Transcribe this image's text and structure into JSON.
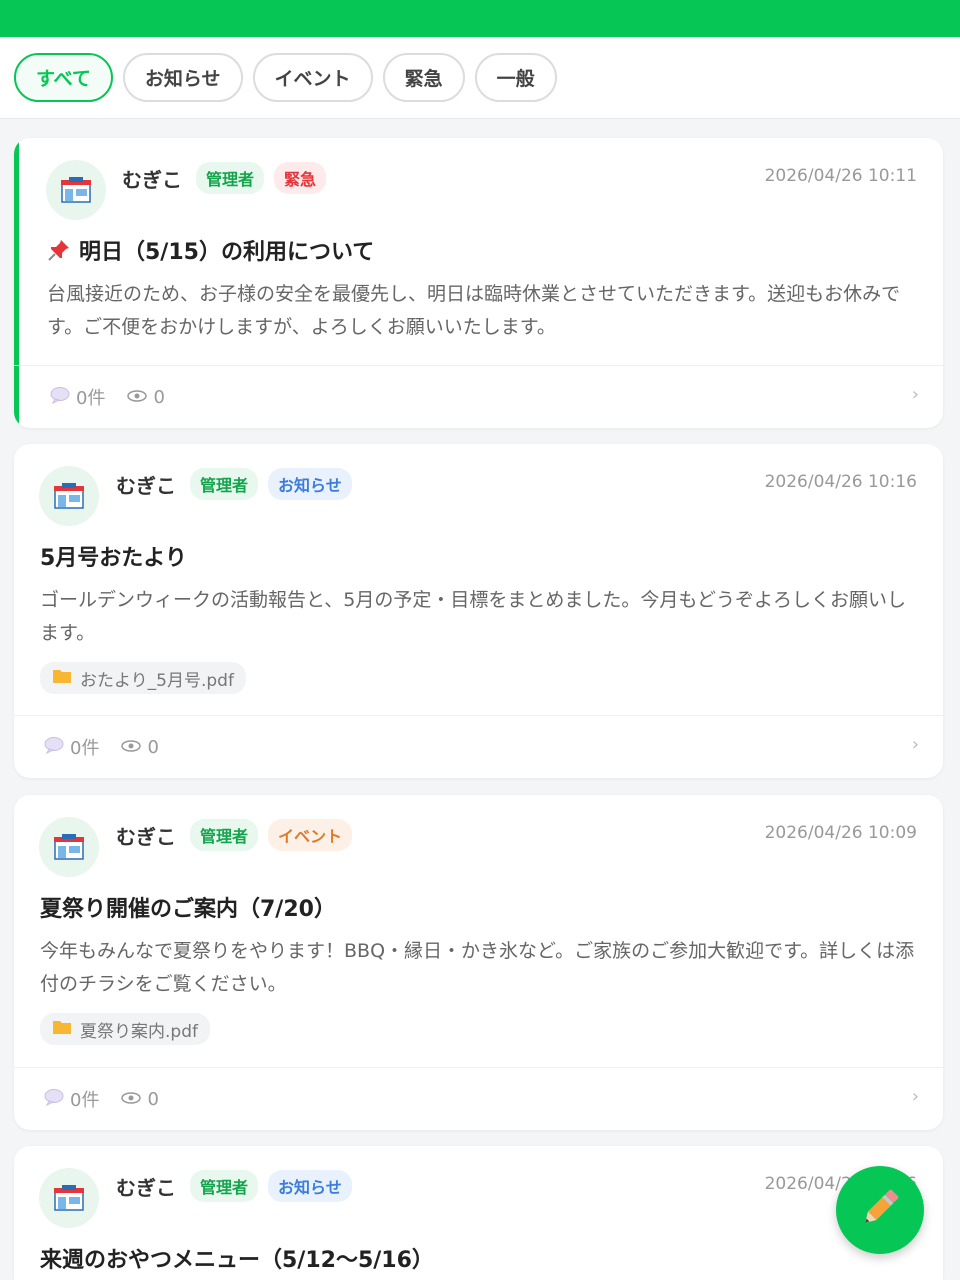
{
  "filters": [
    "すべて",
    "お知らせ",
    "イベント",
    "緊急",
    "一般"
  ],
  "posts": [
    {
      "author": "むぎこ",
      "role": "管理者",
      "category": "緊急",
      "time": "2026/04/26 10:11",
      "pinned": true,
      "title": "明日（5/15）の利用について",
      "body": "台風接近のため、お子様の安全を最優先し、明日は臨時休業とさせていただきます。送迎もお休みです。ご不便をおかけしますが、よろしくお願いいたします。",
      "comments": "0件",
      "views": "0"
    },
    {
      "author": "むぎこ",
      "role": "管理者",
      "category": "お知らせ",
      "time": "2026/04/26 10:16",
      "title": "5月号おたより",
      "body": "ゴールデンウィークの活動報告と、5月の予定・目標をまとめました。今月もどうぞよろしくお願いします。",
      "attachment": "おたより_5月号.pdf",
      "comments": "0件",
      "views": "0"
    },
    {
      "author": "むぎこ",
      "role": "管理者",
      "category": "イベント",
      "time": "2026/04/26 10:09",
      "title": "夏祭り開催のご案内（7/20）",
      "body": "今年もみんなで夏祭りをやります！BBQ・縁日・かき氷など。ご家族のご参加大歓迎です。詳しくは添付のチラシをご覧ください。",
      "attachment": "夏祭り案内.pdf",
      "comments": "0件",
      "views": "0"
    },
    {
      "author": "むぎこ",
      "role": "管理者",
      "category": "お知らせ",
      "time": "2026/04/26 10:16",
      "title": "来週のおやつメニュー（5/12〜5/16）"
    }
  ],
  "colors": {
    "brand": "#06c755",
    "urgent": "#e5343a",
    "info": "#3b7ddd",
    "event": "#e07a2a"
  },
  "icons": {
    "avatar": "store-icon",
    "pin": "pushpin-icon",
    "comment": "speech-bubble-icon",
    "views": "eye-icon",
    "attachment": "folder-icon",
    "fab": "pencil-icon"
  }
}
